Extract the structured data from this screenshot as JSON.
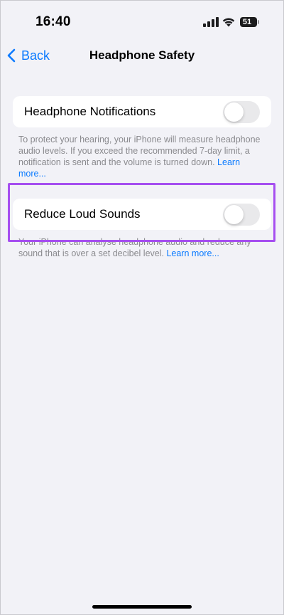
{
  "status_bar": {
    "time": "16:40",
    "battery_level": "51"
  },
  "nav": {
    "back_label": "Back",
    "title": "Headphone Safety"
  },
  "headphone_notifications": {
    "label": "Headphone Notifications",
    "toggle_on": false,
    "footer_text": "To protect your hearing, your iPhone will measure headphone audio levels. If you exceed the recommended 7-day limit, a notification is sent and the volume is turned down.",
    "learn_more": "Learn more..."
  },
  "reduce_loud_sounds": {
    "label": "Reduce Loud Sounds",
    "toggle_on": false,
    "footer_text": "Your iPhone can analyse headphone audio and reduce any sound that is over a set decibel level.",
    "learn_more": "Learn more..."
  },
  "colors": {
    "accent": "#0a7aff",
    "background": "#f2f2f7",
    "highlight": "#a64ff0",
    "toggle_off": "#e9e9eb"
  }
}
